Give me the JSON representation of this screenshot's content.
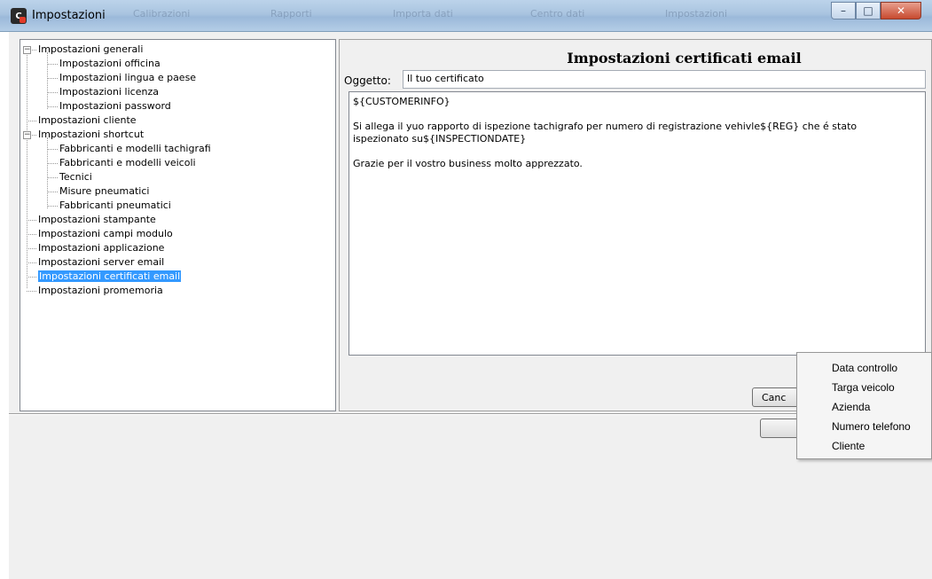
{
  "window": {
    "title": "Impostazioni",
    "app_icon": "C",
    "background_tabs": [
      "Calibrazioni",
      "Rapporti",
      "Importa dati",
      "Centro dati",
      "Impostazioni"
    ],
    "controls": {
      "minimize": "–",
      "maximize": "□",
      "close": "✕"
    }
  },
  "tree": {
    "items": [
      {
        "label": "Impostazioni generali",
        "level": 0,
        "toggle": "−"
      },
      {
        "label": "Impostazioni officina",
        "level": 1
      },
      {
        "label": "Impostazioni lingua e paese",
        "level": 1
      },
      {
        "label": "Impostazioni licenza",
        "level": 1
      },
      {
        "label": "Impostazioni password",
        "level": 1
      },
      {
        "label": "Impostazioni cliente",
        "level": 0
      },
      {
        "label": "Impostazioni shortcut",
        "level": 0,
        "toggle": "−"
      },
      {
        "label": "Fabbricanti e modelli tachigrafi",
        "level": 1
      },
      {
        "label": "Fabbricanti e modelli veicoli",
        "level": 1
      },
      {
        "label": "Tecnici",
        "level": 1
      },
      {
        "label": "Misure pneumatici",
        "level": 1
      },
      {
        "label": "Fabbricanti pneumatici",
        "level": 1
      },
      {
        "label": "Impostazioni stampante",
        "level": 0
      },
      {
        "label": "Impostazioni campi modulo",
        "level": 0
      },
      {
        "label": "Impostazioni applicazione",
        "level": 0
      },
      {
        "label": "Impostazioni server email",
        "level": 0
      },
      {
        "label": "Impostazioni certificati email",
        "level": 0,
        "selected": true
      },
      {
        "label": "Impostazioni promemoria",
        "level": 0
      }
    ]
  },
  "panel": {
    "header": "Impostazioni certificati email",
    "subject_label": "Oggetto:",
    "subject_value": "Il tuo certificato",
    "body_text": "${CUSTOMERINFO}\n\nSi allega il yuo rapporto di ispezione tachigrafo per numero di registrazione vehivle${REG} che é stato\nispezionato su${INSPECTIONDATE}\n\nGrazie per il vostro business molto apprezzato.",
    "cancel_label": "Canc"
  },
  "context_menu": {
    "items": [
      "Data controllo",
      "Targa veicolo",
      "Azienda",
      "Numero telefono",
      "Cliente"
    ]
  },
  "colors": {
    "selection": "#3399ff",
    "titlebar": "#a9c4e0",
    "close_button": "#c74a2f"
  }
}
